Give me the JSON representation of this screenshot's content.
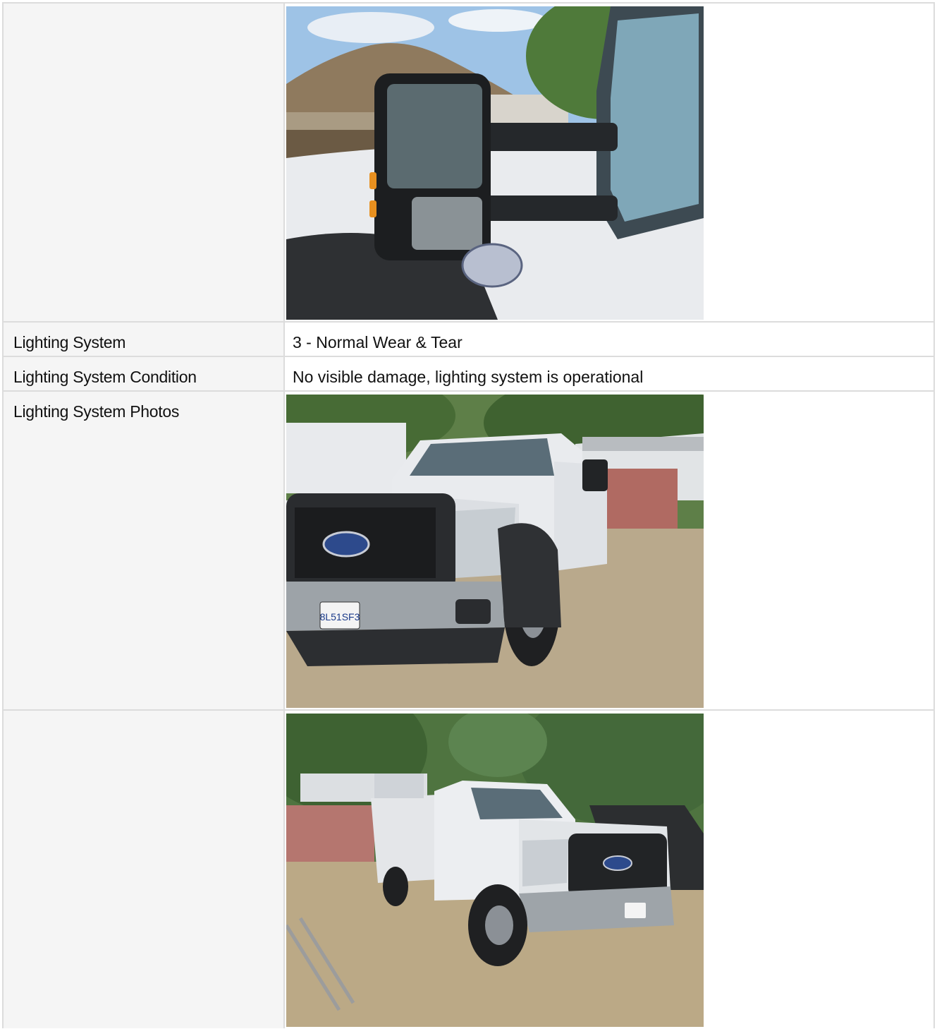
{
  "rows": [
    {
      "type": "photo",
      "label": "",
      "photo": "side-mirror-photo"
    },
    {
      "type": "text",
      "label": "Lighting System",
      "value": "3 - Normal Wear & Tear"
    },
    {
      "type": "text",
      "label": "Lighting System Condition",
      "value": "No visible damage, lighting system is operational"
    },
    {
      "type": "photo",
      "label": "Lighting System Photos",
      "photo": "truck-front-photo"
    },
    {
      "type": "photo",
      "label": "",
      "photo": "truck-angle-photo"
    }
  ],
  "photos": {
    "side-mirror-photo": {
      "description_icon": "mirror-photo"
    },
    "truck-front-photo": {
      "description_icon": "truck-photo",
      "plate": "8L51SF3"
    },
    "truck-angle-photo": {
      "description_icon": "truck-photo"
    }
  },
  "colors": {
    "label_bg": "#f5f5f5",
    "border": "#dcdcdc",
    "truck_white": "#e9ebee",
    "sky": "#9ec3e6",
    "ground": "#b9a98c"
  }
}
